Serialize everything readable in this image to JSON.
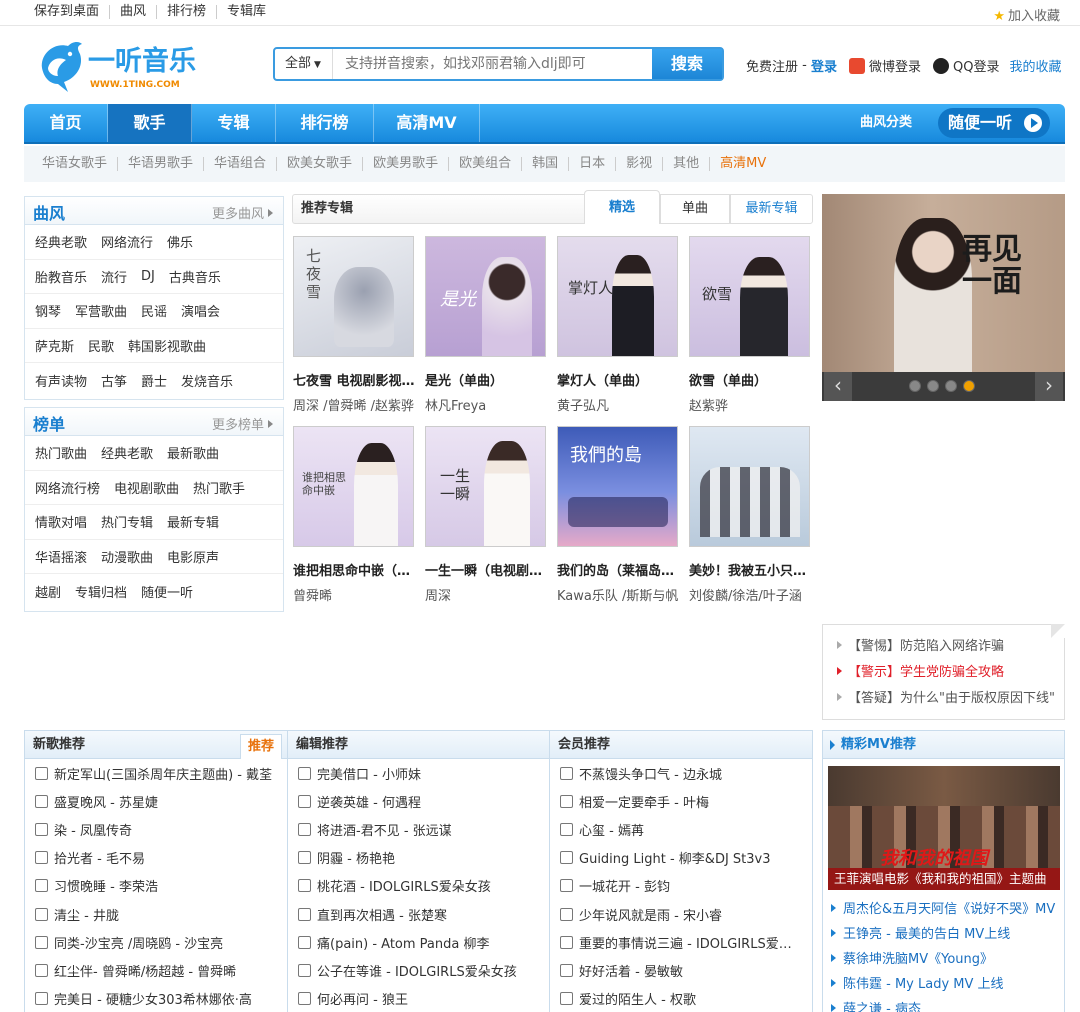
{
  "topbar": {
    "links": [
      "保存到桌面",
      "曲风",
      "排行榜",
      "专辑库"
    ],
    "favorite": "加入收藏"
  },
  "header": {
    "logo_text": "一听音乐",
    "logo_url": "WWW.1TING.COM",
    "search_category": "全部",
    "search_placeholder": "支持拼音搜索，如找邓丽君输入dlj即可",
    "search_button": "搜索",
    "register": "免费注册",
    "login": "登录",
    "weibo_login": "微博登录",
    "qq_login": "QQ登录",
    "my_favorites": "我的收藏"
  },
  "nav": {
    "items": [
      "首页",
      "歌手",
      "专辑",
      "排行榜",
      "高清MV"
    ],
    "active": "歌手",
    "style_category": "曲风分类",
    "random_listen": "随便一听"
  },
  "subnav": [
    "华语女歌手",
    "华语男歌手",
    "华语组合",
    "欧美女歌手",
    "欧美男歌手",
    "欧美组合",
    "韩国",
    "日本",
    "影视",
    "其他",
    "高清MV"
  ],
  "genre_box": {
    "title": "曲风",
    "more": "更多曲风",
    "rows": [
      [
        "经典老歌",
        "网络流行",
        "佛乐"
      ],
      [
        "胎教音乐",
        "流行",
        "DJ",
        "古典音乐"
      ],
      [
        "钢琴",
        "军营歌曲",
        "民谣",
        "演唱会"
      ],
      [
        "萨克斯",
        "民歌",
        "韩国影视歌曲"
      ],
      [
        "有声读物",
        "古筝",
        "爵士",
        "发烧音乐"
      ]
    ]
  },
  "chart_box": {
    "title": "榜单",
    "more": "更多榜单",
    "rows": [
      [
        "热门歌曲",
        "经典老歌",
        "最新歌曲"
      ],
      [
        "网络流行榜",
        "电视剧歌曲",
        "热门歌手"
      ],
      [
        "情歌对唱",
        "热门专辑",
        "最新专辑"
      ],
      [
        "华语摇滚",
        "动漫歌曲",
        "电影原声"
      ],
      [
        "越剧",
        "专辑归档",
        "随便一听"
      ]
    ]
  },
  "albums_header": {
    "title": "推荐专辑",
    "tabs": [
      "精选",
      "单曲",
      "最新专辑"
    ]
  },
  "albums": [
    {
      "name": "七夜雪 电视剧影视原声带",
      "artist": "周深 /曾舜晞 /赵紫骅"
    },
    {
      "name": "是光（单曲）",
      "artist": "林凡Freya"
    },
    {
      "name": "掌灯人（单曲）",
      "artist": "黄子弘凡"
    },
    {
      "name": "欲雪（单曲）",
      "artist": "赵紫骅"
    },
    {
      "name": "谁把相思命中嵌（单曲）",
      "artist": "曾舜晞"
    },
    {
      "name": "一生一瞬（电视剧插曲）",
      "artist": "周深"
    },
    {
      "name": "我们的岛（莱福岛主题曲）",
      "artist": "Kawa乐队 /斯斯与帆"
    },
    {
      "name": "美妙！我被五小只包围了",
      "artist": "刘俊麟/徐浩/叶子涵"
    }
  ],
  "banner": {
    "title_text": "再见一面",
    "left_arrow": "‹",
    "right_arrow": "›",
    "active_slide": 4
  },
  "notices": [
    {
      "text": "【警惕】防范陷入网络诈骗"
    },
    {
      "text": "【警示】学生党防骗全攻略"
    },
    {
      "text": "【答疑】为什么\"由于版权原因下线\""
    }
  ],
  "lists": {
    "new_songs": {
      "title": "新歌推荐",
      "badge": "推荐",
      "items": [
        "新定军山(三国杀周年庆主题曲) - 戴荃",
        "盛夏晚风 - 苏星婕",
        "染 - 凤凰传奇",
        "拾光者 - 毛不易",
        "习惯晚睡 - 李荣浩",
        "清尘 - 井胧",
        "同类-沙宝亮 /周晓鸥 - 沙宝亮",
        "红尘伴- 曾舜晞/杨超越 - 曾舜晞",
        "完美日 - 硬糖少女303希林娜依·高"
      ]
    },
    "editor": {
      "title": "编辑推荐",
      "items": [
        "完美借口 - 小师妹",
        "逆袭英雄 - 何遇程",
        "将进酒-君不见 - 张远谋",
        "阴霾 - 杨艳艳",
        "桃花酒 - IDOLGIRLS爱朵女孩",
        "直到再次相遇 - 张楚寒",
        "痛(pain) - Atom Panda 柳李",
        "公子在等谁 - IDOLGIRLS爱朵女孩",
        "何必再问 - 狼王"
      ]
    },
    "members": {
      "title": "会员推荐",
      "items": [
        "不蒸馒头争口气 - 边永城",
        "相爱一定要牵手 - 叶梅",
        "心玺 - 嫣苒",
        "Guiding Light - 柳李&DJ St3v3",
        "一城花开 - 彭钧",
        "少年说风就是雨 - 宋小睿",
        "重要的事情说三遍 - IDOLGIRLS爱朵女孩",
        "好好活着 - 晏敏敏",
        "爱过的陌生人 - 权歌"
      ]
    }
  },
  "mv": {
    "title": "精彩MV推荐",
    "caption": "王菲演唱电影《我和我的祖国》主题曲",
    "poster_text": "我和我的祖国",
    "items": [
      "周杰伦&五月天阿信《说好不哭》MV",
      "王铮亮 - 最美的告白 MV上线",
      "蔡徐坤洗脑MV《Young》",
      "陈伟霆 - My Lady MV 上线",
      "薛之谦 - 病态"
    ]
  },
  "colors": {
    "primary": "#1a7fcf",
    "nav_gradient_top": "#3fb0f6",
    "nav_gradient_bottom": "#1789dd",
    "accent_orange": "#e8720c",
    "alert_red": "#e0202a"
  }
}
